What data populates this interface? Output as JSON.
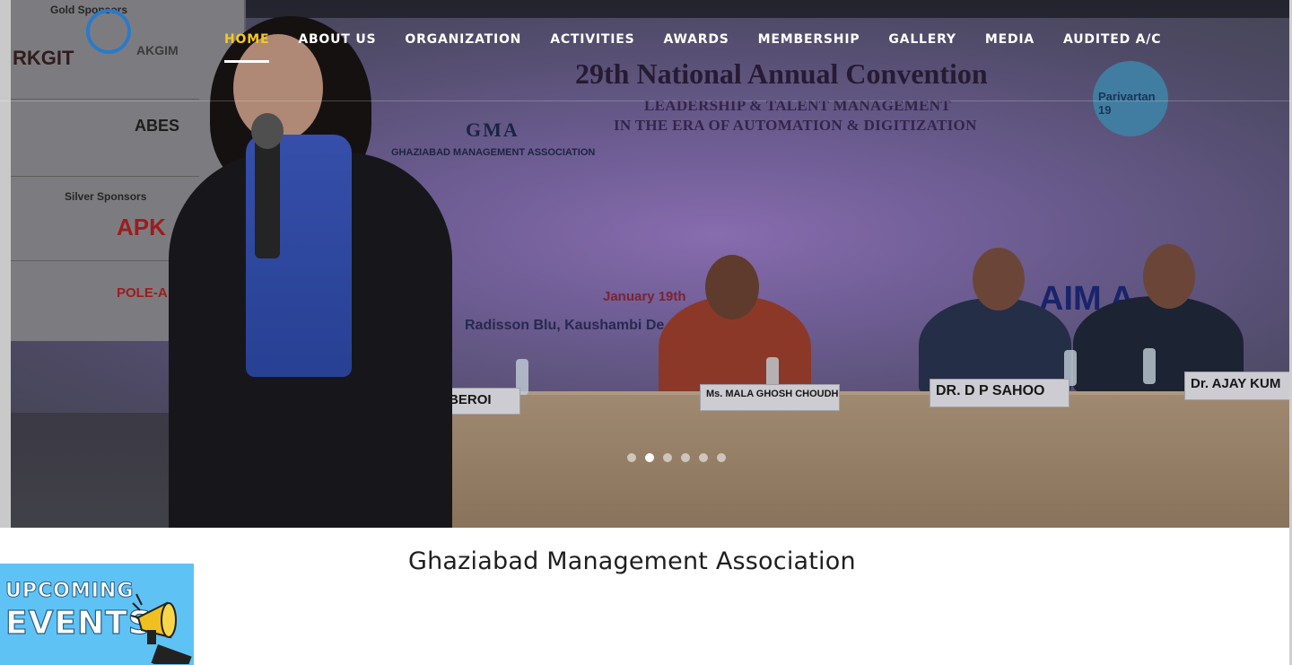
{
  "site": {
    "logo_name": "AKGIM",
    "heading": "Ghaziabad Management Association"
  },
  "nav": {
    "items": [
      {
        "label": "HOME",
        "active": true
      },
      {
        "label": "ABOUT US",
        "active": false
      },
      {
        "label": "ORGANIZATION",
        "active": false
      },
      {
        "label": "ACTIVITIES",
        "active": false
      },
      {
        "label": "AWARDS",
        "active": false
      },
      {
        "label": "MEMBERSHIP",
        "active": false
      },
      {
        "label": "GALLERY",
        "active": false
      },
      {
        "label": "MEDIA",
        "active": false
      },
      {
        "label": "AUDITED A/C",
        "active": false
      }
    ],
    "active_color": "#f4c81c"
  },
  "slider": {
    "total_slides": 6,
    "active_slide": 2,
    "banner": {
      "title": "29th National Annual Convention",
      "subtitle_line1": "LEADERSHIP & TALENT MANAGEMENT",
      "subtitle_line2": "IN THE ERA OF  AUTOMATION & DIGITIZATION",
      "org": "GHAZIABAD MANAGEMENT ASSOCIATION",
      "org_short": "GMA",
      "date": "January 19th",
      "venue": "Radisson Blu, Kaushambi De",
      "aim": "AIM A",
      "parivartan": "Parivartan 19"
    },
    "sponsors": {
      "gold_title": "Gold Sponsors",
      "silver_title": "Silver Sponsors",
      "logos": [
        "RKGIT",
        "AKGIM",
        "ABES",
        "APK",
        "POLE-A"
      ]
    },
    "nameplates": [
      "RIMY OBEROI",
      "Ms. MALA GHOSH CHOUDHURY",
      "DR. D P SAHOO",
      "Dr. AJAY KUM"
    ]
  },
  "upcoming": {
    "line1": "UPCOMING",
    "line2": "EVENTS",
    "color": "#5fc2f4"
  }
}
